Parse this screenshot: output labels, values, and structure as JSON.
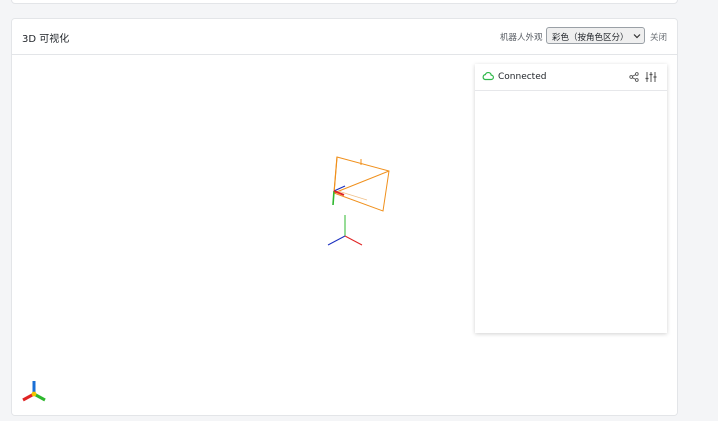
{
  "panel": {
    "title": "3D 可视化"
  },
  "toolbar": {
    "appearance_label": "机器人外观",
    "appearance_selected": "彩色（按角色区分）",
    "close_label": "关闭"
  },
  "side_panel": {
    "status": "Connected"
  },
  "colors": {
    "robot_outline": "#f0901c",
    "axis_x": "#e02424",
    "axis_y": "#2fb82f",
    "axis_z": "#1a2fbf",
    "gizmo_center": "#f5c400",
    "connected": "#2fb84a"
  },
  "icons": {
    "status": "cloud-icon",
    "share": "share-icon",
    "settings": "sliders-icon",
    "select_chevron": "chevron-down-icon"
  }
}
